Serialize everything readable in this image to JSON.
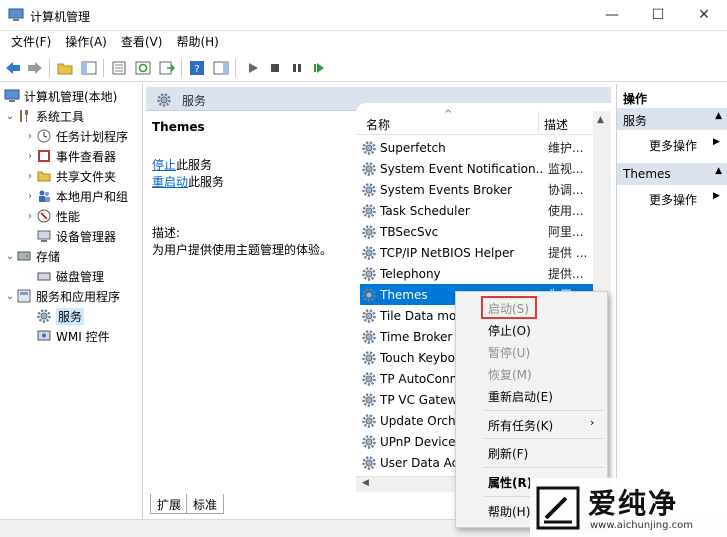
{
  "window": {
    "title": "计算机管理",
    "minimize": "—",
    "maximize": "☐",
    "close": "✕"
  },
  "menubar": [
    "文件(F)",
    "操作(A)",
    "查看(V)",
    "帮助(H)"
  ],
  "tree": {
    "root": "计算机管理(本地)",
    "system_tools": "系统工具",
    "task_scheduler": "任务计划程序",
    "event_viewer": "事件查看器",
    "shared_folders": "共享文件夹",
    "local_users": "本地用户和组",
    "performance": "性能",
    "device_manager": "设备管理器",
    "storage": "存储",
    "disk_mgmt": "磁盘管理",
    "services_apps": "服务和应用程序",
    "services": "服务",
    "wmi": "WMI 控件"
  },
  "header": {
    "title": "服务"
  },
  "desc": {
    "service_name": "Themes",
    "stop_link": "停止",
    "stop_suffix": "此服务",
    "restart_link": "重启动",
    "restart_suffix": "此服务",
    "desc_label": "描述:",
    "desc_text": "为用户提供使用主题管理的体验。"
  },
  "columns": {
    "name": "名称",
    "desc": "描述"
  },
  "services": [
    {
      "name": "Superfetch",
      "desc": "维护..."
    },
    {
      "name": "System Event Notification...",
      "desc": "监视..."
    },
    {
      "name": "System Events Broker",
      "desc": "协调..."
    },
    {
      "name": "Task Scheduler",
      "desc": "使用..."
    },
    {
      "name": "TBSecSvc",
      "desc": "阿里..."
    },
    {
      "name": "TCP/IP NetBIOS Helper",
      "desc": "提供 ..."
    },
    {
      "name": "Telephony",
      "desc": "提供..."
    },
    {
      "name": "Themes",
      "desc": "为用..."
    },
    {
      "name": "Tile Data model server",
      "desc": ""
    },
    {
      "name": "Time Broker",
      "desc": ""
    },
    {
      "name": "Touch Keyboard",
      "desc": ""
    },
    {
      "name": "TP AutoConnect",
      "desc": ""
    },
    {
      "name": "TP VC Gateway",
      "desc": ""
    },
    {
      "name": "Update Orchestrator",
      "desc": ""
    },
    {
      "name": "UPnP Device Host",
      "desc": ""
    },
    {
      "name": "User Data Access",
      "desc": ""
    }
  ],
  "tabs": [
    "扩展",
    "标准"
  ],
  "actions": {
    "title": "操作",
    "group1": "服务",
    "more1": "更多操作",
    "group2": "Themes",
    "more2": "更多操作"
  },
  "context_menu": {
    "start": "启动(S)",
    "stop": "停止(O)",
    "pause": "暂停(U)",
    "resume": "恢复(M)",
    "restart": "重新启动(E)",
    "all_tasks": "所有任务(K)",
    "refresh": "刷新(F)",
    "properties": "属性(R)",
    "help": "帮助(H)"
  },
  "watermark": {
    "brand": "爱纯净",
    "url": "www.aichunjing.com"
  },
  "colors": {
    "accent": "#0078d7",
    "highlight_box": "#e53935",
    "pane_header": "#dbe4ee"
  }
}
